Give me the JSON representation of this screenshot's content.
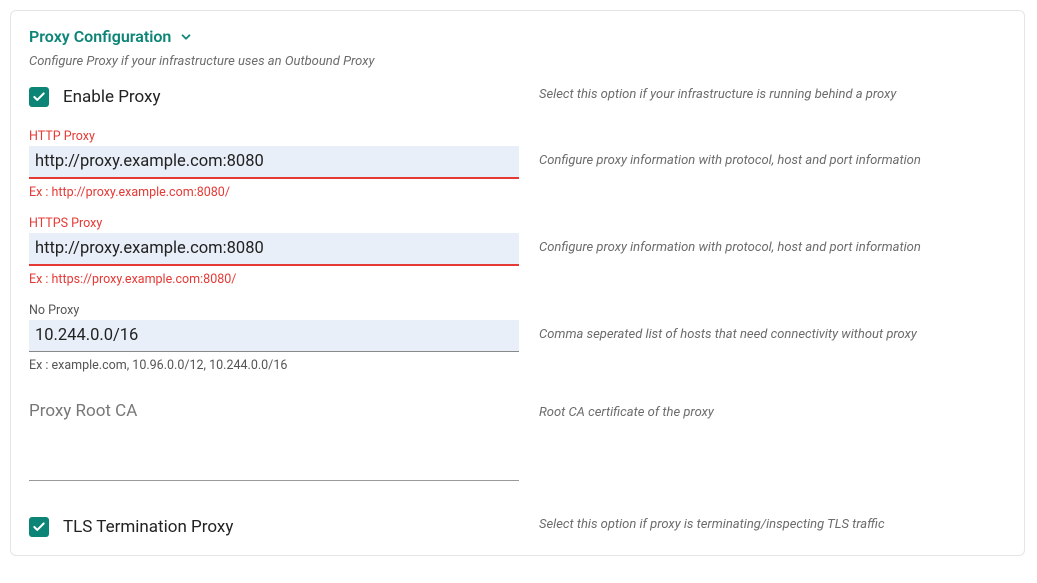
{
  "section": {
    "title": "Proxy Configuration",
    "subtitle": "Configure Proxy if your infrastructure uses an Outbound Proxy"
  },
  "enable_proxy": {
    "label": "Enable Proxy",
    "checked": true,
    "help": "Select this option if your infrastructure is running behind a proxy"
  },
  "http_proxy": {
    "label": "HTTP Proxy",
    "value": "http://proxy.example.com:8080",
    "hint": "Ex : http://proxy.example.com:8080/",
    "help": "Configure proxy information with protocol, host and port information"
  },
  "https_proxy": {
    "label": "HTTPS Proxy",
    "value": "http://proxy.example.com:8080",
    "hint": "Ex : https://proxy.example.com:8080/",
    "help": "Configure proxy information with protocol, host and port information"
  },
  "no_proxy": {
    "label": "No Proxy",
    "value": "10.244.0.0/16",
    "hint": "Ex : example.com, 10.96.0.0/12, 10.244.0.0/16",
    "help": "Comma seperated list of hosts that need connectivity without proxy"
  },
  "root_ca": {
    "label": "Proxy Root CA",
    "help": "Root CA certificate of the proxy"
  },
  "tls_termination": {
    "label": "TLS Termination Proxy",
    "checked": true,
    "help": "Select this option if proxy is terminating/inspecting TLS traffic"
  }
}
